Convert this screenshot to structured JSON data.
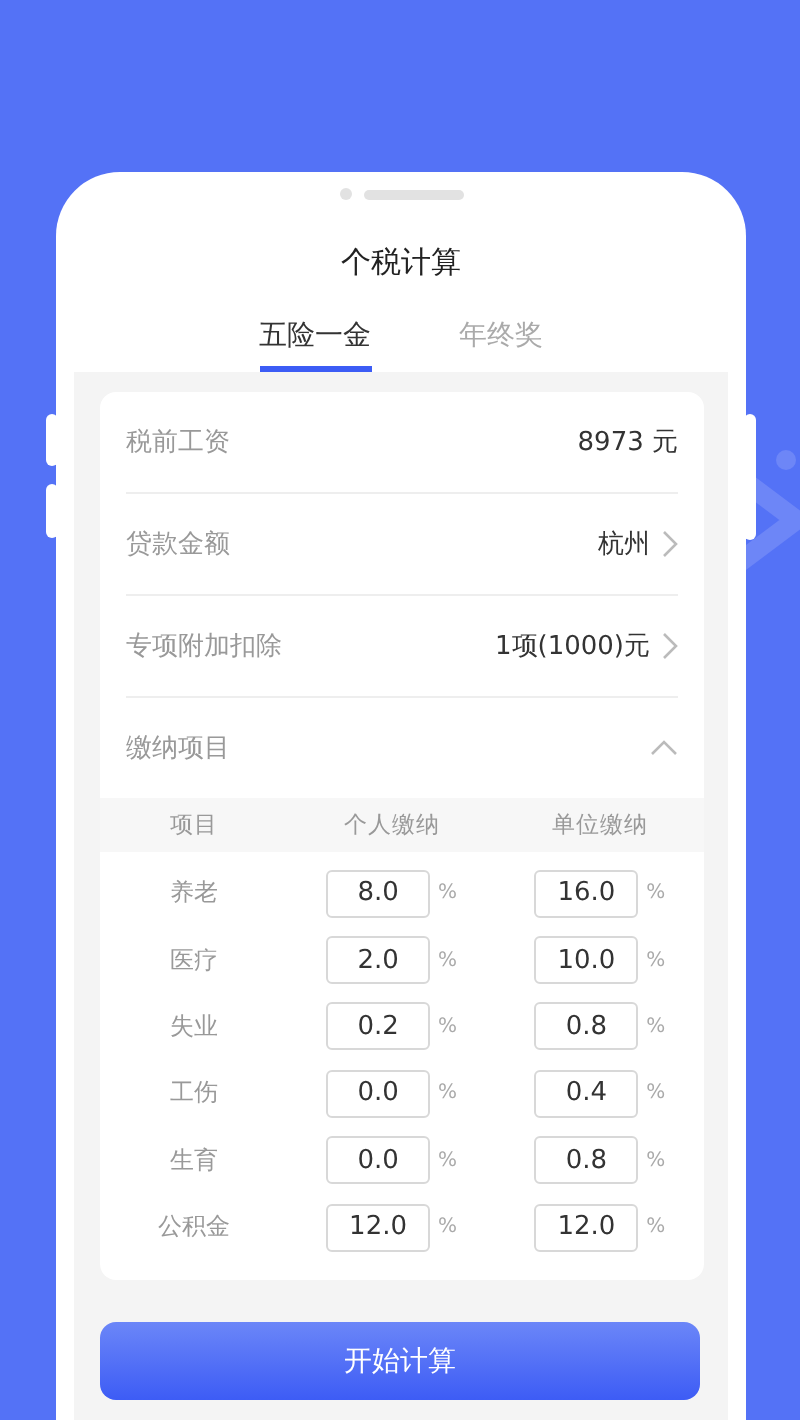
{
  "title": "个税计算",
  "tabs": [
    {
      "label": "五险一金",
      "selected": true
    },
    {
      "label": "年终奖",
      "selected": false
    }
  ],
  "fields": [
    {
      "kind": "value",
      "label": "税前工资",
      "value": "8973 元"
    },
    {
      "kind": "link",
      "label": "贷款金额",
      "value": "杭州"
    },
    {
      "kind": "link",
      "label": "专项附加扣除",
      "value": "1项(1000)元"
    },
    {
      "kind": "section",
      "label": "缴纳项目",
      "expanded": true
    }
  ],
  "table": {
    "columns": [
      "项目",
      "个人缴纳",
      "单位缴纳"
    ],
    "rows": [
      {
        "item": "养老",
        "personal": "8.0",
        "personal_unit": "%",
        "company": "16.0",
        "company_unit": "%"
      },
      {
        "item": "医疗",
        "personal": "2.0",
        "personal_unit": "%",
        "company": "10.0",
        "company_unit": "%"
      },
      {
        "item": "失业",
        "personal": "0.2",
        "personal_unit": "%",
        "company": "0.8",
        "company_unit": "%"
      },
      {
        "item": "工伤",
        "personal": "0.0",
        "personal_unit": "%",
        "company": "0.4",
        "company_unit": "%"
      },
      {
        "item": "生育",
        "personal": "0.0",
        "personal_unit": "%",
        "company": "0.8",
        "company_unit": "%"
      },
      {
        "item": "公积金",
        "personal": "12.0",
        "personal_unit": "%",
        "company": "12.0",
        "company_unit": "%"
      }
    ]
  },
  "button": "开始计算"
}
